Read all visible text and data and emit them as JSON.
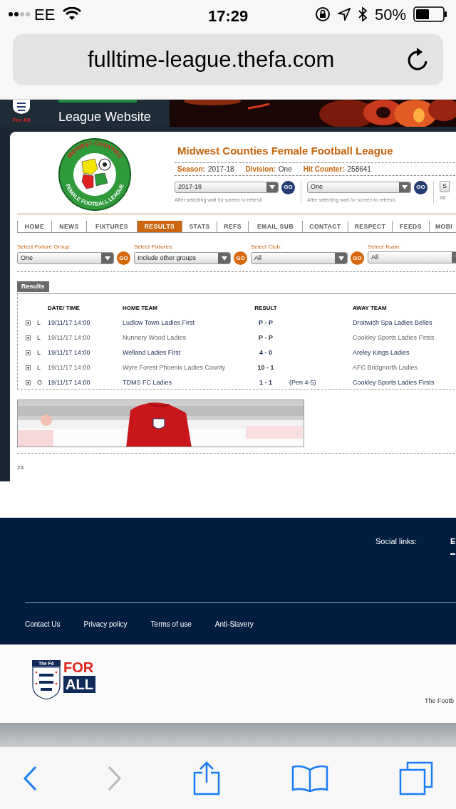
{
  "status_bar": {
    "carrier": "EE",
    "time": "17:29",
    "battery": "50%"
  },
  "address_bar": {
    "url": "fulltime-league.thefa.com"
  },
  "site_header": {
    "crest_caption": "For All",
    "title": "League Website"
  },
  "league_logo": {
    "top_text": "MIDWEST COUNTIES",
    "bottom_text": "FEMALE FOOTBALL LEAGUE"
  },
  "league": {
    "name": "Midwest Counties Female Football League",
    "info": [
      {
        "label": "Season:",
        "value": "2017-18"
      },
      {
        "label": "Division:",
        "value": "One"
      },
      {
        "label": "Hit Counter:",
        "value": "258641"
      }
    ]
  },
  "selectors": [
    {
      "value": "2017-18",
      "button": "GO",
      "hint": "After selecting wait for screen to refresh"
    },
    {
      "value": "One",
      "button": "GO",
      "hint": "After selecting wait for screen to refresh"
    },
    {
      "value": "S",
      "hint": "Aft"
    }
  ],
  "nav_tabs": [
    {
      "label": "HOME",
      "selected": false
    },
    {
      "label": "NEWS",
      "selected": false
    },
    {
      "label": "FIXTURES",
      "selected": false
    },
    {
      "label": "RESULTS",
      "selected": true
    },
    {
      "label": "STATS",
      "selected": false
    },
    {
      "label": "REFS",
      "selected": false
    },
    {
      "label": "EMAIL SUB",
      "selected": false
    },
    {
      "label": "CONTACT",
      "selected": false
    },
    {
      "label": "RESPECT",
      "selected": false
    },
    {
      "label": "FEEDS",
      "selected": false
    },
    {
      "label": "MOBI",
      "selected": false
    }
  ],
  "filters": [
    {
      "label": "Select Fixture Group:",
      "value": "One",
      "button": "GO"
    },
    {
      "label": "Select Fixtures:",
      "value": "Include other groups",
      "button": "GO"
    },
    {
      "label": "Select Club:",
      "value": "All",
      "button": "GO"
    },
    {
      "label": "Select Team:",
      "value": "All"
    }
  ],
  "results": {
    "tab": "Results",
    "columns": [
      "DATE/ TIME",
      "HOME TEAM",
      "RESULT",
      "AWAY TEAM"
    ],
    "rows": [
      {
        "type": "L",
        "date": "19/11/17 14:00",
        "home": "Ludlow Town Ladies First",
        "result": "P - P",
        "away": "Droitwich Spa Ladies Belles",
        "dimmed": false
      },
      {
        "type": "L",
        "date": "19/11/17 14:00",
        "home": "Nunnery Wood Ladies",
        "result": "P - P",
        "away": "Cookley Sports Ladies Firsts",
        "dimmed": true
      },
      {
        "type": "L",
        "date": "19/11/17 14:00",
        "home": "Welland Ladies First",
        "result": "4 - 0",
        "away": "Areley Kings Ladies",
        "dimmed": false
      },
      {
        "type": "L",
        "date": "19/11/17 14:00",
        "home": "Wyre Forest Phoenix Ladies County",
        "result": "10 - 1",
        "away": "AFC Bridgnorth Ladies",
        "dimmed": true
      },
      {
        "type": "O",
        "date": "19/11/17 14:00",
        "home": "TDMS FC Ladies",
        "result": "1 - 1",
        "note": "(Pen 4-5)",
        "away": "Cookley Sports Ladies Firsts",
        "dimmed": false
      }
    ]
  },
  "page_number": "23",
  "footer": {
    "social_label": "Social links:",
    "social_first": "E",
    "links": [
      "Contact Us",
      "Privacy policy",
      "Terms of use",
      "Anti-Slavery"
    ],
    "badge_top": "The FA",
    "badge_for": "FOR",
    "badge_all": "ALL",
    "copyright": "The Footb"
  }
}
